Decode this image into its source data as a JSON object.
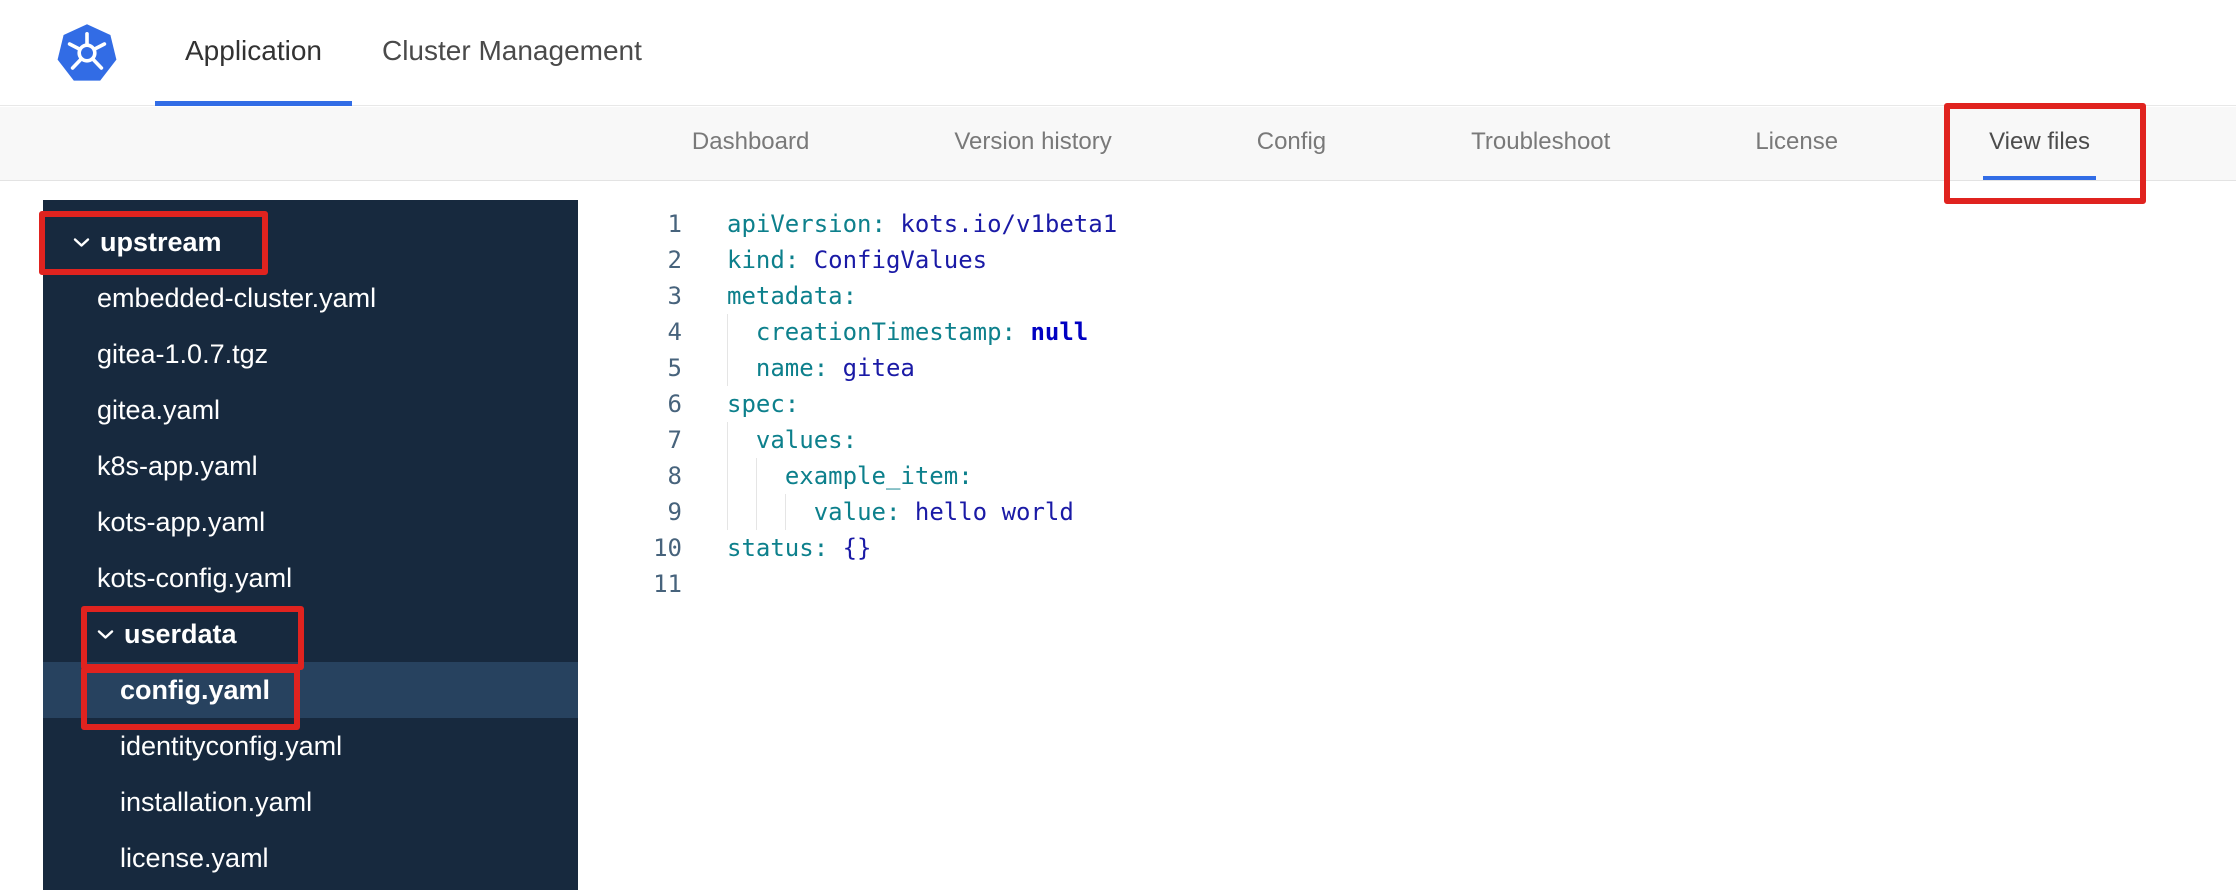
{
  "topnav": {
    "tabs": [
      "Application",
      "Cluster Management"
    ],
    "active": "Application"
  },
  "subnav": {
    "items": [
      "Dashboard",
      "Version history",
      "Config",
      "Troubleshoot",
      "License",
      "View files"
    ],
    "active": "View files"
  },
  "filetree": {
    "items": [
      {
        "label": "upstream",
        "type": "folder",
        "depth": 0,
        "expanded": true,
        "annotated": true
      },
      {
        "label": "embedded-cluster.yaml",
        "type": "file",
        "depth": 1
      },
      {
        "label": "gitea-1.0.7.tgz",
        "type": "file",
        "depth": 1
      },
      {
        "label": "gitea.yaml",
        "type": "file",
        "depth": 1
      },
      {
        "label": "k8s-app.yaml",
        "type": "file",
        "depth": 1
      },
      {
        "label": "kots-app.yaml",
        "type": "file",
        "depth": 1
      },
      {
        "label": "kots-config.yaml",
        "type": "file",
        "depth": 1
      },
      {
        "label": "userdata",
        "type": "folder",
        "depth": 1,
        "expanded": true,
        "annotated": true
      },
      {
        "label": "config.yaml",
        "type": "file",
        "depth": 2,
        "selected": true,
        "annotated": true
      },
      {
        "label": "identityconfig.yaml",
        "type": "file",
        "depth": 2
      },
      {
        "label": "installation.yaml",
        "type": "file",
        "depth": 2
      },
      {
        "label": "license.yaml",
        "type": "file",
        "depth": 2
      }
    ]
  },
  "editor": {
    "lines": [
      {
        "num": 1,
        "indent": 0,
        "tokens": [
          {
            "c": "key",
            "t": "apiVersion:"
          },
          {
            "c": "plain",
            "t": " "
          },
          {
            "c": "value",
            "t": "kots.io/v1beta1"
          }
        ]
      },
      {
        "num": 2,
        "indent": 0,
        "tokens": [
          {
            "c": "key",
            "t": "kind:"
          },
          {
            "c": "plain",
            "t": " "
          },
          {
            "c": "value",
            "t": "ConfigValues"
          }
        ]
      },
      {
        "num": 3,
        "indent": 0,
        "tokens": [
          {
            "c": "key",
            "t": "metadata:"
          }
        ]
      },
      {
        "num": 4,
        "indent": 1,
        "tokens": [
          {
            "c": "key",
            "t": "creationTimestamp:"
          },
          {
            "c": "plain",
            "t": " "
          },
          {
            "c": "null",
            "t": "null"
          }
        ]
      },
      {
        "num": 5,
        "indent": 1,
        "tokens": [
          {
            "c": "key",
            "t": "name:"
          },
          {
            "c": "plain",
            "t": " "
          },
          {
            "c": "value",
            "t": "gitea"
          }
        ]
      },
      {
        "num": 6,
        "indent": 0,
        "tokens": [
          {
            "c": "key",
            "t": "spec:"
          }
        ]
      },
      {
        "num": 7,
        "indent": 1,
        "tokens": [
          {
            "c": "key",
            "t": "values:"
          }
        ]
      },
      {
        "num": 8,
        "indent": 2,
        "tokens": [
          {
            "c": "key",
            "t": "example_item:"
          }
        ]
      },
      {
        "num": 9,
        "indent": 3,
        "tokens": [
          {
            "c": "key",
            "t": "value:"
          },
          {
            "c": "plain",
            "t": " "
          },
          {
            "c": "value",
            "t": "hello world"
          }
        ]
      },
      {
        "num": 10,
        "indent": 0,
        "tokens": [
          {
            "c": "key",
            "t": "status:"
          },
          {
            "c": "plain",
            "t": " "
          },
          {
            "c": "value",
            "t": "{}"
          }
        ]
      },
      {
        "num": 11,
        "indent": 0,
        "tokens": []
      }
    ]
  },
  "colors": {
    "accent_blue": "#326de6",
    "annotation_red": "#e0231f",
    "sidebar_bg": "#17293e",
    "sidebar_selected_bg": "#27425f",
    "code_key": "#0d808c",
    "code_value": "#1a1aa6",
    "code_null": "#0000c2"
  }
}
